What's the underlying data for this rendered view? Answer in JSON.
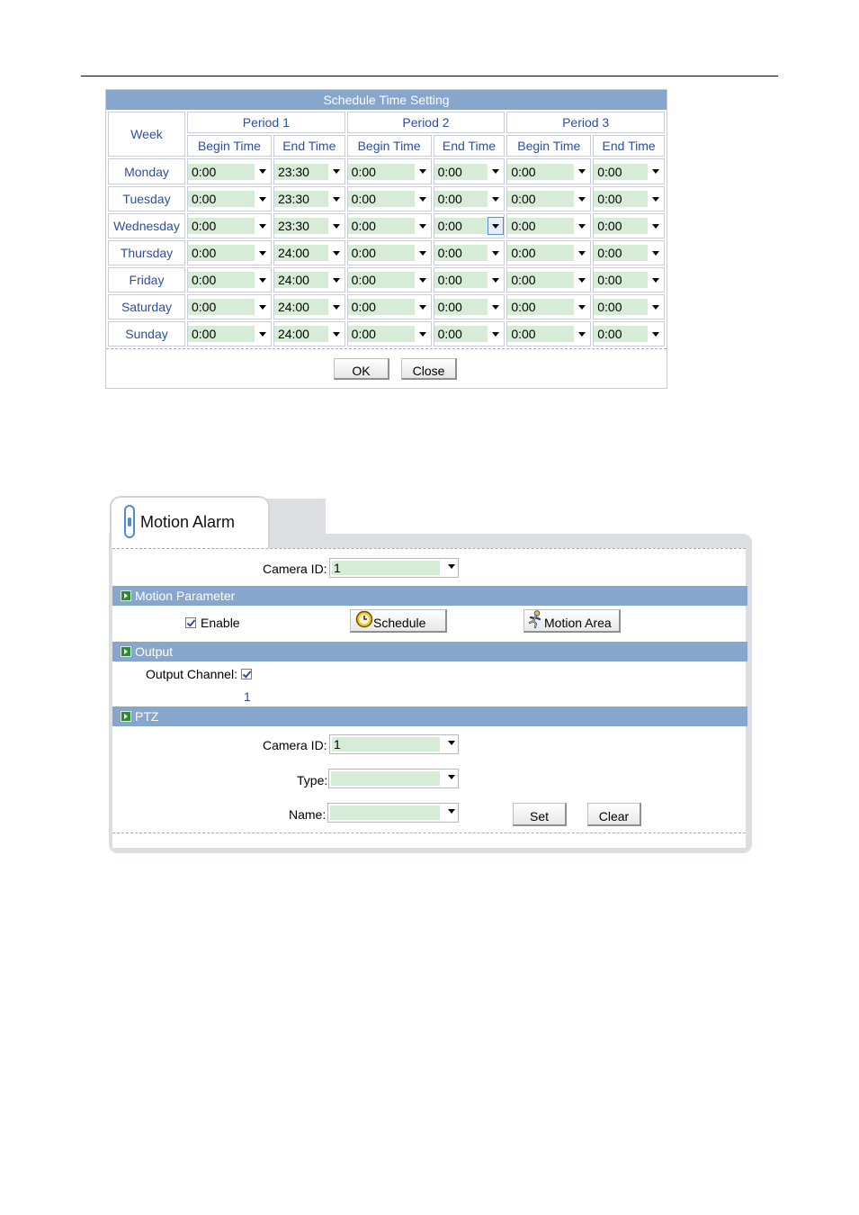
{
  "schedule": {
    "title": "Schedule Time Setting",
    "week_header": "Week",
    "periods": [
      "Period 1",
      "Period 2",
      "Period 3"
    ],
    "begin_label": "Begin Time",
    "end_label": "End Time",
    "rows": [
      {
        "day": "Monday",
        "times": [
          "0:00",
          "23:30",
          "0:00",
          "0:00",
          "0:00",
          "0:00"
        ]
      },
      {
        "day": "Tuesday",
        "times": [
          "0:00",
          "23:30",
          "0:00",
          "0:00",
          "0:00",
          "0:00"
        ]
      },
      {
        "day": "Wednesday",
        "times": [
          "0:00",
          "23:30",
          "0:00",
          "0:00",
          "0:00",
          "0:00"
        ]
      },
      {
        "day": "Thursday",
        "times": [
          "0:00",
          "24:00",
          "0:00",
          "0:00",
          "0:00",
          "0:00"
        ]
      },
      {
        "day": "Friday",
        "times": [
          "0:00",
          "24:00",
          "0:00",
          "0:00",
          "0:00",
          "0:00"
        ]
      },
      {
        "day": "Saturday",
        "times": [
          "0:00",
          "24:00",
          "0:00",
          "0:00",
          "0:00",
          "0:00"
        ]
      },
      {
        "day": "Sunday",
        "times": [
          "0:00",
          "24:00",
          "0:00",
          "0:00",
          "0:00",
          "0:00"
        ]
      }
    ],
    "ok_label": "OK",
    "close_label": "Close"
  },
  "motion_alarm": {
    "tab_title": "Motion Alarm",
    "camera_id_label": "Camera ID:",
    "camera_id_value": "1",
    "motion_parameter": {
      "title": "Motion Parameter",
      "enable_label": "Enable",
      "enable_checked": true,
      "schedule_label": "Schedule",
      "motion_area_label": "Motion Area"
    },
    "output": {
      "title": "Output",
      "channel_label": "Output Channel:",
      "channel_checked": true,
      "channel_number": "1"
    },
    "ptz": {
      "title": "PTZ",
      "camera_id_label": "Camera ID:",
      "camera_id_value": "1",
      "type_label": "Type:",
      "type_value": "",
      "name_label": "Name:",
      "name_value": "",
      "set_label": "Set",
      "clear_label": "Clear"
    }
  }
}
